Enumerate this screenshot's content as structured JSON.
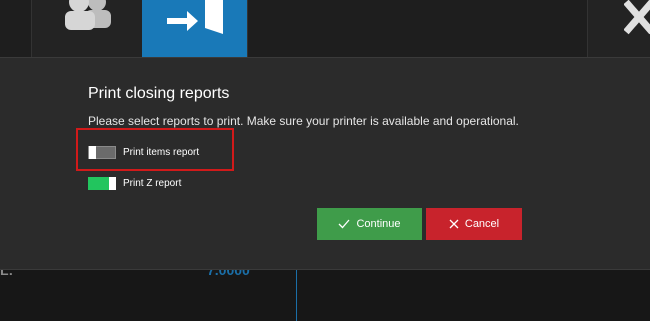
{
  "toolbar": {
    "users_icon": "users-icon",
    "exit_icon": "exit-icon",
    "close_icon": "close-x-icon"
  },
  "background": {
    "label": "L:",
    "value": "7.0000",
    "accent": "#1979b8"
  },
  "dialog": {
    "title": "Print closing reports",
    "instructions": "Please select reports to print. Make sure your printer is available and operational.",
    "options": [
      {
        "label": "Print items report",
        "checked": false
      },
      {
        "label": "Print Z report",
        "checked": true
      }
    ],
    "continue_label": "Continue",
    "cancel_label": "Cancel",
    "continue_color": "#3f9c4a",
    "cancel_color": "#c8232c",
    "highlight_color": "#d11a1a"
  }
}
